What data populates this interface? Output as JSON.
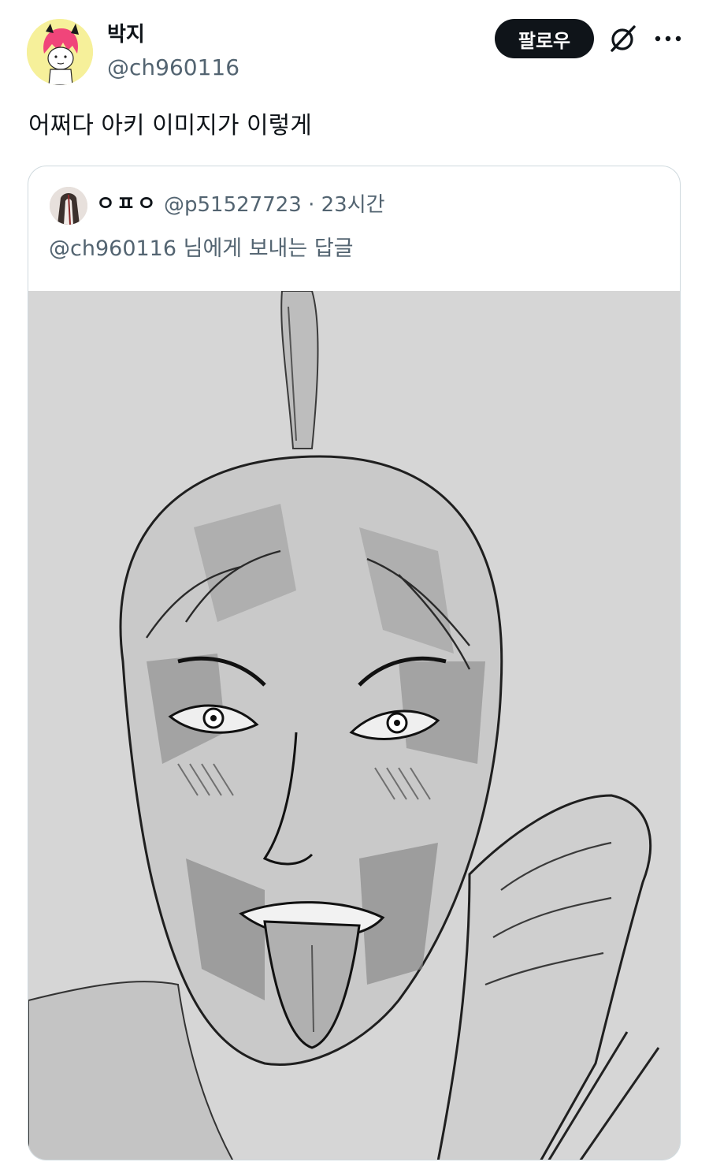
{
  "tweet": {
    "author_name": "박지",
    "author_handle": "@ch960116",
    "follow_label": "팔로우",
    "text": "어쩌다 아키 이미지가 이렇게",
    "icons": {
      "grok": "grok-icon",
      "more": "more-icon",
      "avatar": "avatar"
    }
  },
  "quoted": {
    "author_name": "ㅇㅍㅇ",
    "handle_time": "@p51527723 · 23시간",
    "reply_to": "@ch960116 님에게 보내는 답글"
  },
  "colors": {
    "text": "#0f1419",
    "secondary": "#536471",
    "border": "#cfd9de",
    "button_bg": "#0f1419",
    "image_bg": "#d6d6d6"
  }
}
